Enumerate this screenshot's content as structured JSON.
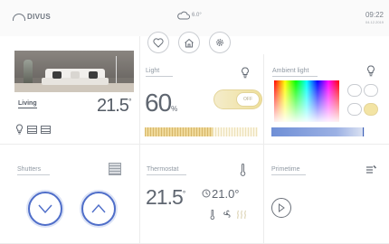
{
  "header": {
    "logo": "DIVUS",
    "weather": "6.0°",
    "time": "09:22",
    "date": "04.12.2019"
  },
  "nav": [
    "heart-icon",
    "home-icon",
    "gear-icon"
  ],
  "living": {
    "label": "Living",
    "temperature": "21.5",
    "unit": "°"
  },
  "light": {
    "title": "Light",
    "value": "60",
    "unit": "%",
    "toggle_label": "OFF",
    "level": 0.6
  },
  "ambient": {
    "title": "Ambient light",
    "level": 0.98
  },
  "shutters": {
    "title": "Shutters"
  },
  "thermostat": {
    "title": "Thermostat",
    "temperature": "21.5",
    "unit": "°",
    "setpoint": "21.0°"
  },
  "primetime": {
    "title": "Primetime"
  },
  "colors": {
    "accent_blue": "#4f6ec9",
    "accent_yellow": "#efe09a"
  }
}
